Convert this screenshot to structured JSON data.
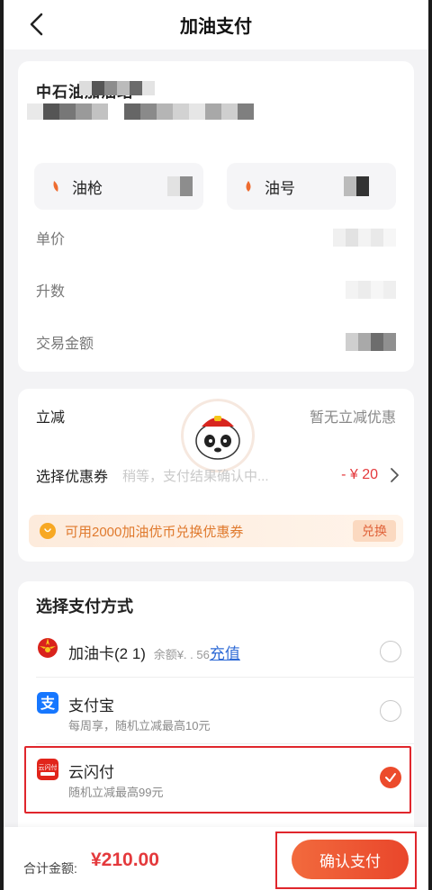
{
  "header": {
    "title": "加油支付"
  },
  "station": {
    "name": "中石油加油站",
    "gun_label": "油枪",
    "oil_label": "油号",
    "rows": [
      {
        "label": "单价"
      },
      {
        "label": "升数"
      },
      {
        "label": "交易金额"
      }
    ]
  },
  "discount": {
    "lijian_label": "立减",
    "lijian_value": "暂无立减优惠",
    "coupon_label": "选择优惠券",
    "toast_text": "稍等，支付结果确认中...",
    "coupon_value": "- ¥ 20",
    "banner_text": "可用2000加油优币兑换优惠券",
    "exchange_label": "兑换"
  },
  "payment": {
    "title": "选择支付方式",
    "methods": [
      {
        "name": "加油卡(2   1)",
        "balance": "余额¥.  .  56",
        "recharge": "充值",
        "selected": false
      },
      {
        "name": "支付宝",
        "sub": "每周享，随机立减最高10元",
        "selected": false
      },
      {
        "name": "云闪付",
        "sub": "随机立减最高99元",
        "selected": true
      }
    ]
  },
  "footer": {
    "total_label": "合计金额:",
    "total_value": "¥210.00",
    "confirm_label": "确认支付"
  },
  "colors": {
    "accent": "#e9462b",
    "price_red": "#e4393c",
    "link_blue": "#2f6bd6",
    "highlight_red": "#e0262c"
  }
}
